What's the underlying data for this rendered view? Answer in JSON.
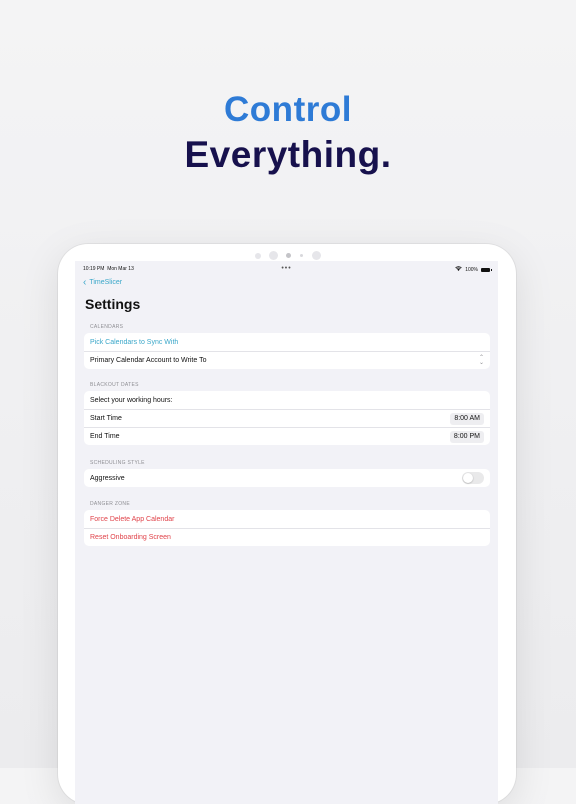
{
  "headline": {
    "line1": "Control",
    "line2": "Everything.",
    "line1_color": "#2e7bd6",
    "line2_color": "#17114d"
  },
  "status_bar": {
    "time": "10:19 PM",
    "date": "Mon Mar 13",
    "dots": "•••",
    "battery": "100%",
    "wifi_icon": "wifi-icon",
    "battery_icon": "battery-icon"
  },
  "nav": {
    "back_label": "TimeSlicer",
    "back_icon": "chevron-left-icon",
    "title": "Settings"
  },
  "sections": {
    "calendars": {
      "header": "CALENDARS",
      "pick_label": "Pick Calendars to Sync With",
      "primary_label": "Primary Calendar Account to Write To",
      "primary_icon": "chevron-up-down-icon"
    },
    "blackout": {
      "header": "BLACKOUT DATES",
      "intro": "Select your working hours:",
      "start_label": "Start Time",
      "start_value": "8:00 AM",
      "end_label": "End Time",
      "end_value": "8:00 PM"
    },
    "scheduling": {
      "header": "SCHEDULING STYLE",
      "aggressive_label": "Aggressive",
      "aggressive_on": false
    },
    "danger": {
      "header": "DANGER ZONE",
      "force_delete": "Force Delete App Calendar",
      "reset_onboarding": "Reset Onboarding Screen"
    }
  },
  "colors": {
    "accent": "#3aa7c9",
    "danger": "#e0434a",
    "background": "#f2f2f7"
  }
}
